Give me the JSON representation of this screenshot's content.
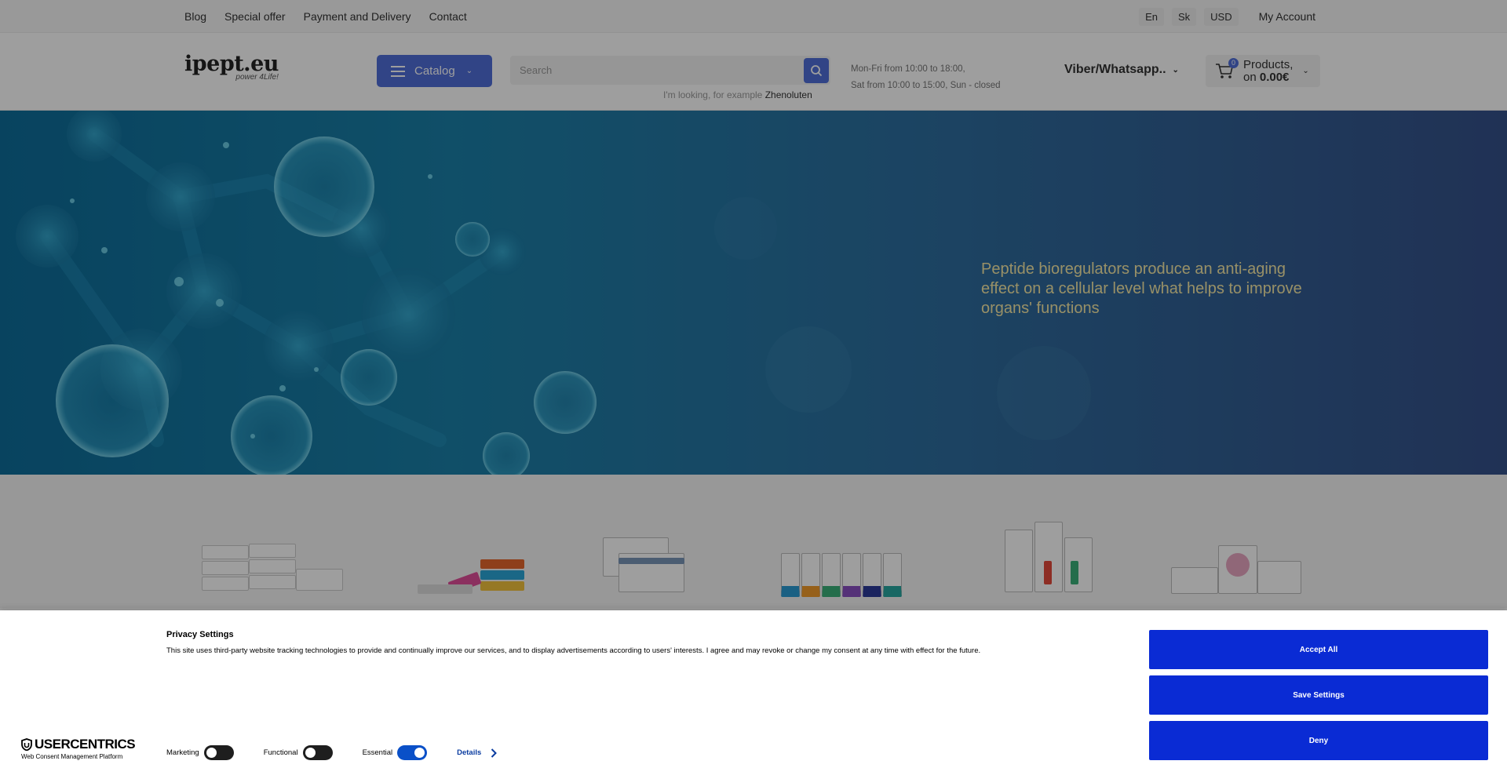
{
  "topbar": {
    "nav": [
      "Blog",
      "Special offer",
      "Payment and Delivery",
      "Contact"
    ],
    "languages": [
      "En",
      "Sk"
    ],
    "currency": "USD",
    "account": "My Account"
  },
  "header": {
    "logo_main": "ipept.eu",
    "logo_sub": "power 4Life!",
    "catalog_label": "Catalog",
    "search_placeholder": "Search",
    "search_hint_prefix": "I'm looking, for example",
    "search_hint_example": "Zhenoluten",
    "hours_line1": "Mon-Fri from 10:00 to 18:00,",
    "hours_line2": "Sat from 10:00 to 15:00, Sun - closed",
    "phone_label": "Viber/Whatsapp..",
    "cart_count": "0",
    "cart_line1": "Products,",
    "cart_line2_prefix": "on",
    "cart_total": "0.00€"
  },
  "hero": {
    "text": "Peptide bioregulators produce an anti-aging effect on a cellular level what helps to improve organs' functions"
  },
  "consent": {
    "title": "Privacy Settings",
    "text": "This site uses third-party website tracking technologies to provide and continually improve our services, and to display advertisements according to users' interests. I agree and may revoke or change my consent at any time with effect for the future.",
    "logo_main": "USERCENTRICS",
    "logo_sub": "Web Consent Management Platform",
    "toggles": [
      {
        "label": "Marketing",
        "on": false
      },
      {
        "label": "Functional",
        "on": false
      },
      {
        "label": "Essential",
        "on": true
      }
    ],
    "details_label": "Details",
    "accept_all": "Accept All",
    "save_settings": "Save Settings",
    "deny": "Deny"
  },
  "colors": {
    "accent": "#4f6fd8",
    "consent_button": "#0a2bd4",
    "hero_text": "#f5e9a6"
  }
}
